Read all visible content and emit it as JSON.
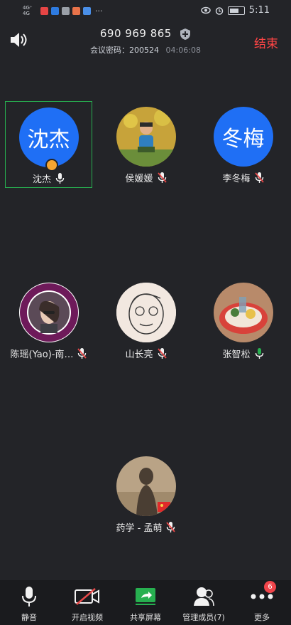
{
  "status_bar": {
    "network_1": "4G⁺",
    "network_2": "4G",
    "time": "5:11",
    "overflow": "···"
  },
  "header": {
    "meeting_id": "690 969 865",
    "password_label": "会议密码：",
    "password": "200524",
    "duration": "04:06:08",
    "end_label": "结束",
    "icons": [
      "speaker-icon",
      "shield-icon"
    ],
    "accent_color": "#ff4545"
  },
  "participants": [
    {
      "name": "沈杰",
      "avatar_text": "沈杰",
      "mic": "on",
      "host": true,
      "active_speaker": true
    },
    {
      "name": "侯媛媛",
      "avatar_text": "",
      "mic": "muted"
    },
    {
      "name": "李冬梅",
      "avatar_text": "冬梅",
      "mic": "muted"
    },
    {
      "name": "陈瑶(Yao)-南…",
      "avatar_text": "",
      "avatar_logo_text": "NANKAI UNIVERSITY 1919",
      "mic": "muted"
    },
    {
      "name": "山长亮",
      "avatar_text": "",
      "mic": "muted"
    },
    {
      "name": "张智松",
      "avatar_text": "",
      "mic": "on"
    },
    {
      "name": "药学 - 孟萌",
      "avatar_text": "",
      "mic": "muted"
    }
  ],
  "colors": {
    "avatar_blue": "#1f6ff5",
    "active_border": "#27b050",
    "mic_on": "#27b050",
    "mic_muted": "#e84a4a"
  },
  "toolbar": {
    "items": [
      {
        "label": "静音",
        "icon": "mic-icon"
      },
      {
        "label": "开启视频",
        "icon": "video-off-icon"
      },
      {
        "label": "共享屏幕",
        "icon": "share-screen-icon"
      },
      {
        "label": "管理成员(7)",
        "icon": "members-icon"
      },
      {
        "label": "更多",
        "icon": "more-icon",
        "badge": "6"
      }
    ]
  }
}
